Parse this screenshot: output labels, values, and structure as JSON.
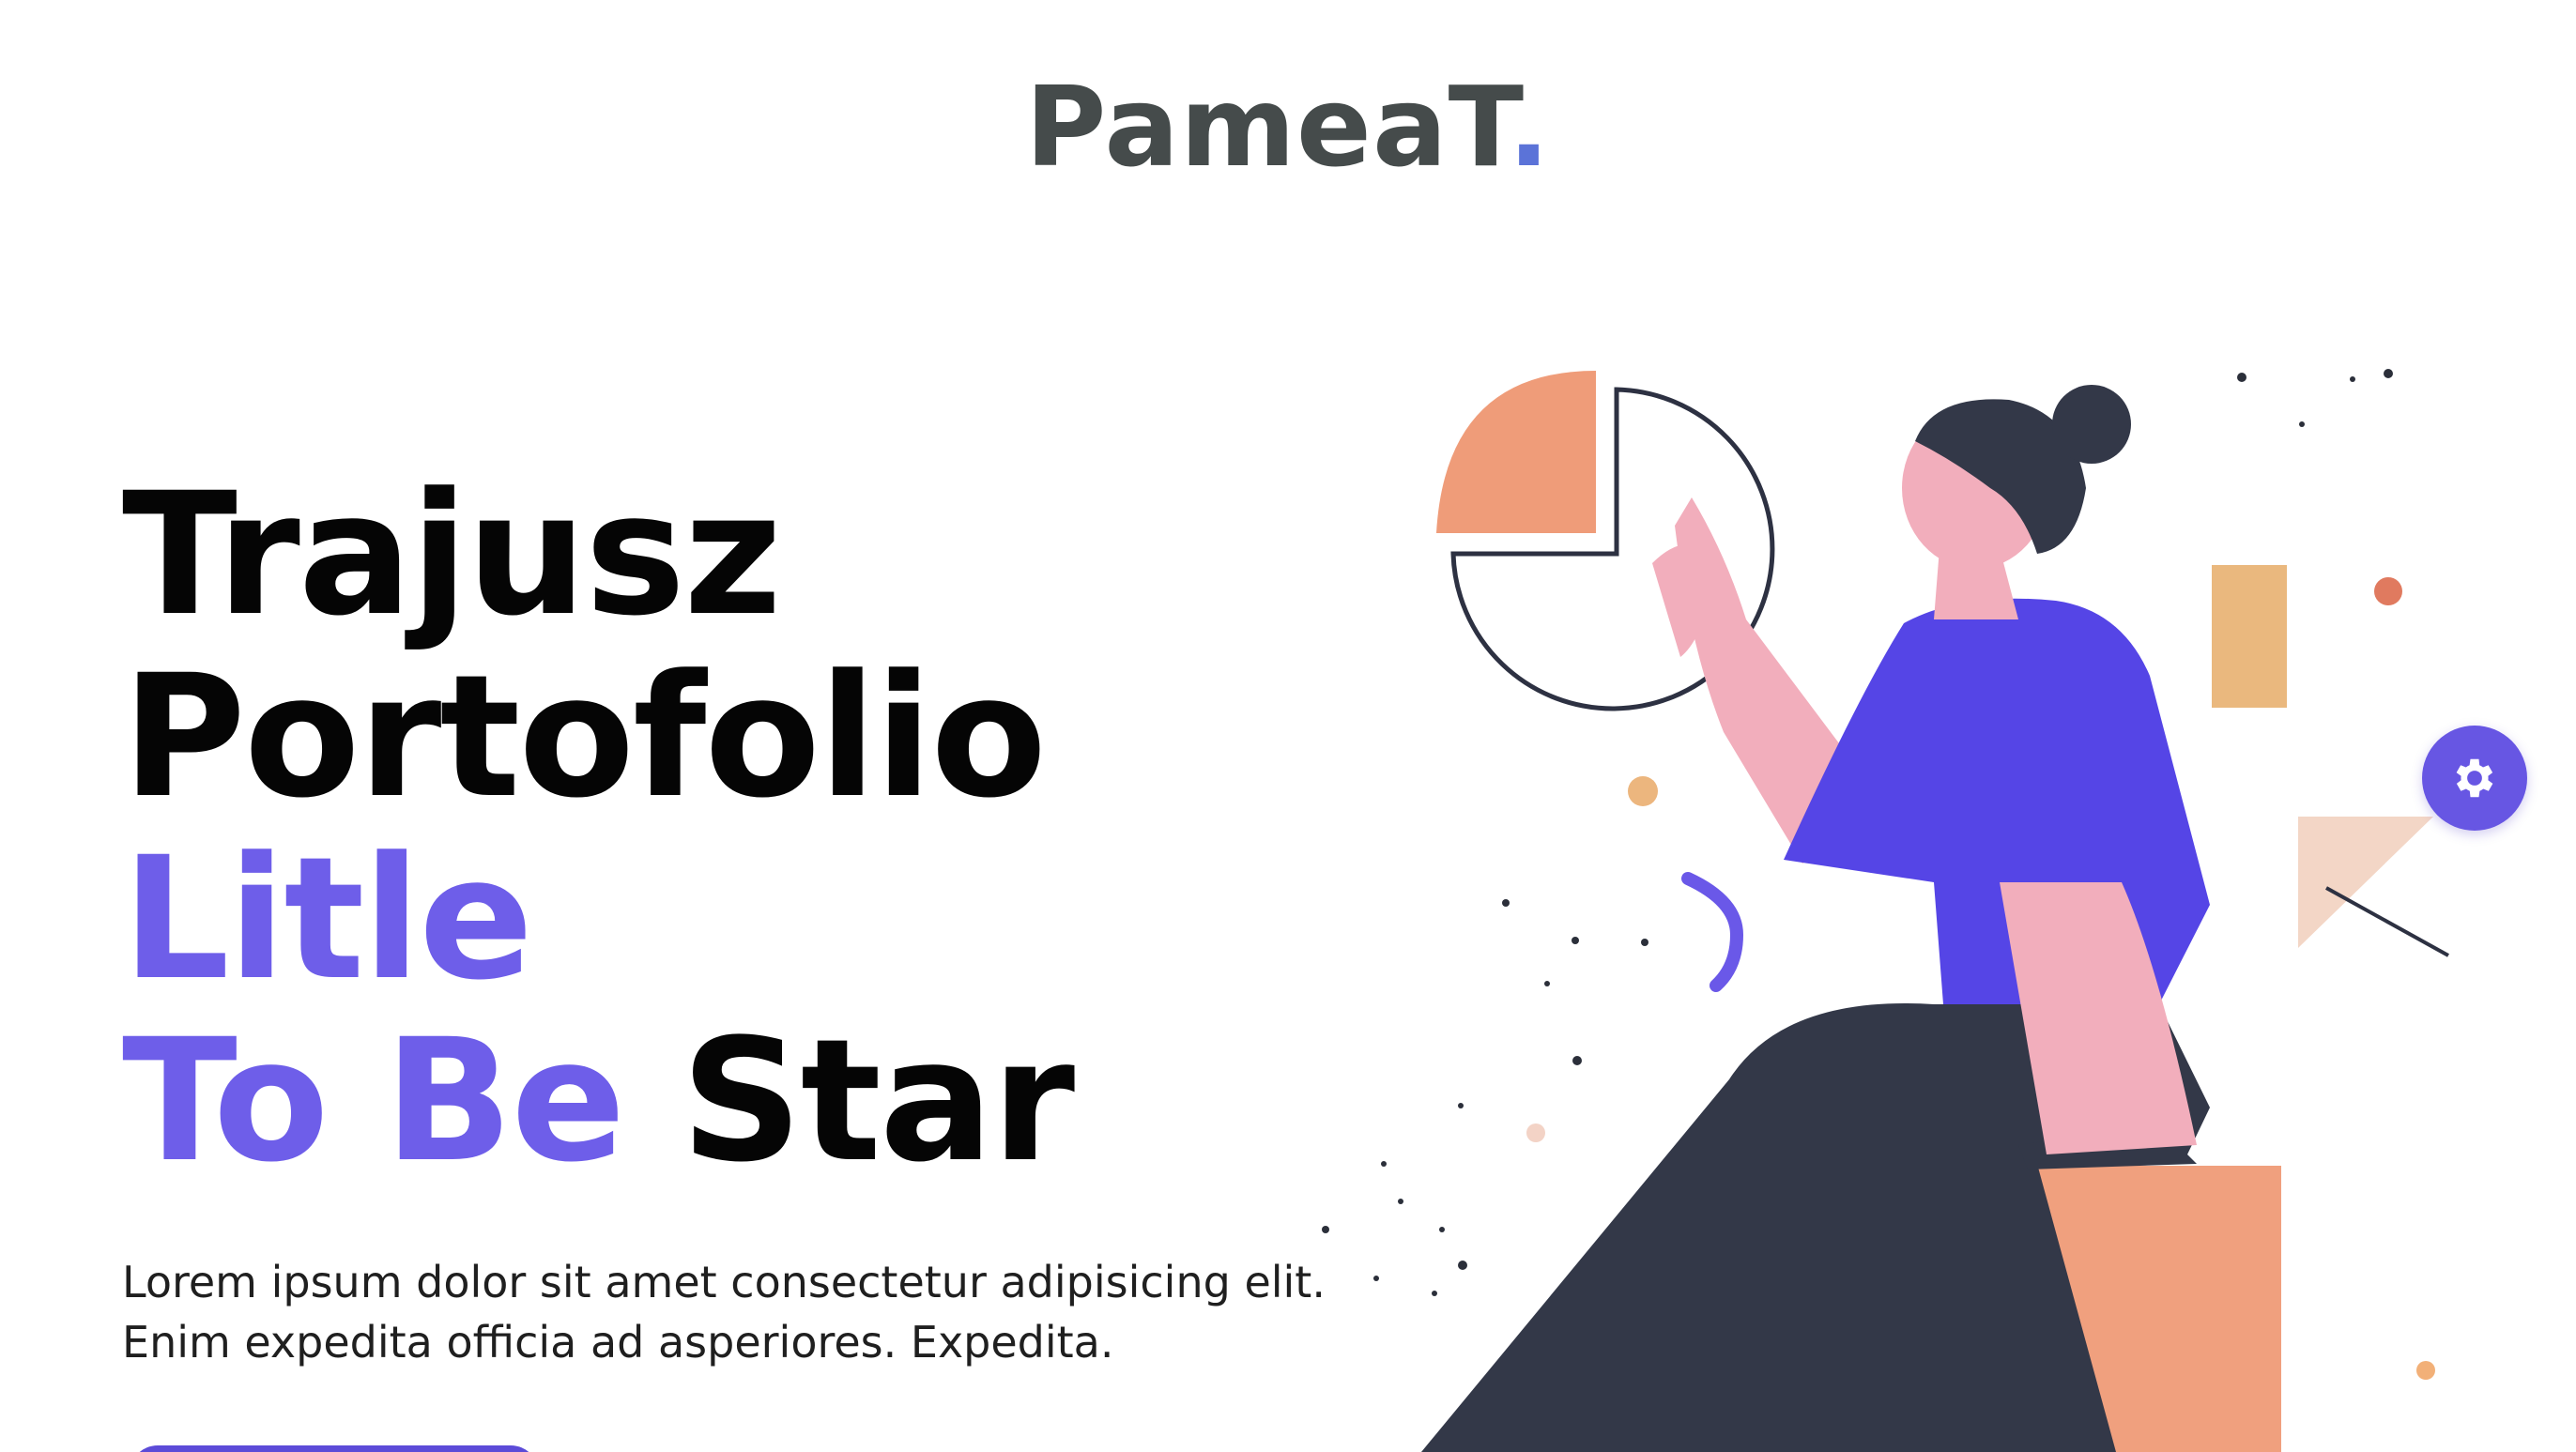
{
  "header": {
    "logo_text": "PameaT",
    "logo_dot": "."
  },
  "hero": {
    "title_line1": "Trajusz",
    "title_line2": "Portofolio",
    "title_line3": "Litle",
    "title_line4_accent": "To Be",
    "title_line4_rest": "Star",
    "description": "Lorem ipsum dolor sit amet consectetur adipisicing elit. Enim expedita officia ad asperiores. Expedita."
  },
  "colors": {
    "accent": "#6e5ee9",
    "logo": "#454b4b",
    "logo_dot": "#5b73d8",
    "fab": "#6756e3"
  },
  "icons": {
    "settings": "gear-icon"
  }
}
